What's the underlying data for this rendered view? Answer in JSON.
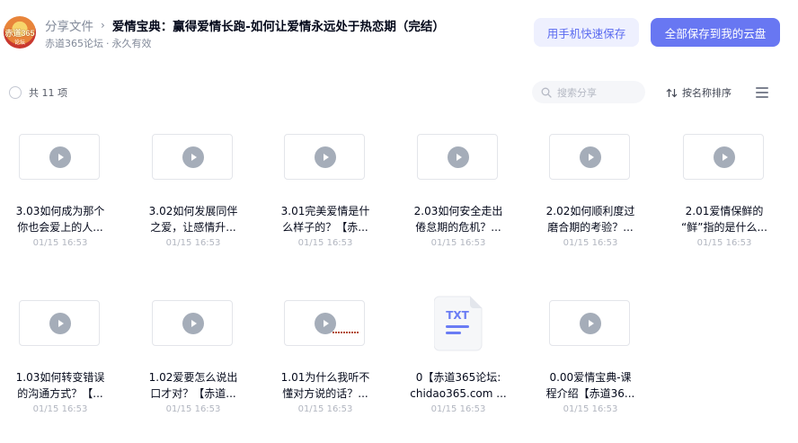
{
  "header": {
    "avatar_text": "赤道365",
    "avatar_sub": "论坛",
    "breadcrumb_parent": "分享文件",
    "breadcrumb_sep": "›",
    "title": "爱情宝典：赢得爱情长跑-如何让爱情永远处于热恋期（完结）",
    "source": "赤道365论坛",
    "dot": "·",
    "validity": "永久有效",
    "phone_save_label": "用手机快速保存",
    "save_all_label": "全部保存到我的云盘"
  },
  "toolbar": {
    "count_label": "共 11 项",
    "search_placeholder": "搜索分享",
    "sort_label": "按名称排序"
  },
  "files": [
    {
      "name_line1": "3.03如何成为那个",
      "name_line2": "你也会爱上的人...",
      "time": "01/15 16:53",
      "icon": "video-icon"
    },
    {
      "name_line1": "3.02如何发展同伴",
      "name_line2": "之爱，让感情升...",
      "time": "01/15 16:53",
      "icon": "video-icon"
    },
    {
      "name_line1": "3.01完美爱情是什",
      "name_line2": "么样子的？【赤...",
      "time": "01/15 16:53",
      "icon": "video-icon"
    },
    {
      "name_line1": "2.03如何安全走出",
      "name_line2": "倦怠期的危机？...",
      "time": "01/15 16:53",
      "icon": "video-icon"
    },
    {
      "name_line1": "2.02如何顺利度过",
      "name_line2": "磨合期的考验？...",
      "time": "01/15 16:53",
      "icon": "video-icon"
    },
    {
      "name_line1": "2.01爱情保鲜的",
      "name_line2": "“鲜”指的是什么...",
      "time": "01/15 16:53",
      "icon": "video-icon"
    },
    {
      "name_line1": "1.03如何转变错误",
      "name_line2": "的沟通方式？【...",
      "time": "01/15 16:53",
      "icon": "video-icon"
    },
    {
      "name_line1": "1.02爱要怎么说出",
      "name_line2": "口才对？【赤道...",
      "time": "01/15 16:53",
      "icon": "video-icon"
    },
    {
      "name_line1": "1.01为什么我听不",
      "name_line2": "懂对方说的话？...",
      "time": "01/15 16:53",
      "icon": "video-icon"
    },
    {
      "name_line1": "0【赤道365论坛:",
      "name_line2": "chidao365.com ...",
      "time": "01/15 16:53",
      "icon": "txt-icon",
      "icon_text": "TXT"
    },
    {
      "name_line1": "0.00爱情宝典-课",
      "name_line2": "程介绍【赤道36...",
      "time": "01/15 16:53",
      "icon": "video-icon"
    }
  ],
  "colors": {
    "primary": "#6877f2",
    "primary_light": "#eef0fe",
    "text": "#03081a",
    "muted": "#818999"
  }
}
